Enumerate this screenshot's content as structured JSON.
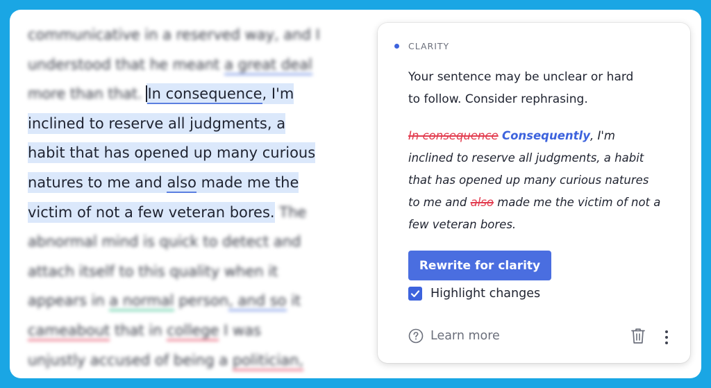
{
  "document": {
    "line1": "communicative in a reserved way, and I",
    "line2_pre": "understood that he meant ",
    "line2_u": "a great deal",
    "line3_blur": "more than that. ",
    "line3_flag": "In consequence",
    "line3_rest": ", I'm",
    "line4": "inclined to reserve all judgments, a",
    "line5": "habit that has opened up many curious",
    "line6_pre": "natures to me and ",
    "line6_u": "also",
    "line6_post": " made me the",
    "line7_sel": "victim of not a few veteran bores.",
    "line7_blur": " The",
    "line8": "abnormal mind is quick to detect and",
    "line9": "attach itself to this quality when it",
    "line10_pre": "appears in ",
    "line10_green": "a normal",
    "line10_mid": " person",
    "line10_blue": ", and so",
    "line10_post": " it",
    "line11_red1": "cameabout",
    "line11_mid": " that in ",
    "line11_red2": "college",
    "line11_post": " I was",
    "line12_pre": "unjustly accused of being a ",
    "line12_red": "politician,"
  },
  "card": {
    "category": "CLARITY",
    "explanation_l1": "Your sentence may be unclear or hard",
    "explanation_l2": "to follow. Consider rephrasing.",
    "preview": {
      "deleted1": "In consequence",
      "inserted1": "Consequently",
      "after1": ", I'm",
      "line2": "inclined to reserve all judgments, a habit",
      "line3": "that has opened up many curious natures",
      "line4_pre": "to me and ",
      "deleted2": "also",
      "line4_post": " made me the victim of not a",
      "line5": "few veteran bores."
    },
    "rewrite_button": "Rewrite for clarity",
    "highlight_label": "Highlight changes",
    "highlight_checked": true,
    "learn_more": "Learn more"
  },
  "colors": {
    "accent": "#4a6ee0",
    "insert": "#3d63dd",
    "delete": "#e23b4e",
    "background": "#1aa6e4"
  },
  "icons": [
    "help-circle-icon",
    "trash-icon",
    "more-vertical-icon",
    "checkmark-icon"
  ]
}
